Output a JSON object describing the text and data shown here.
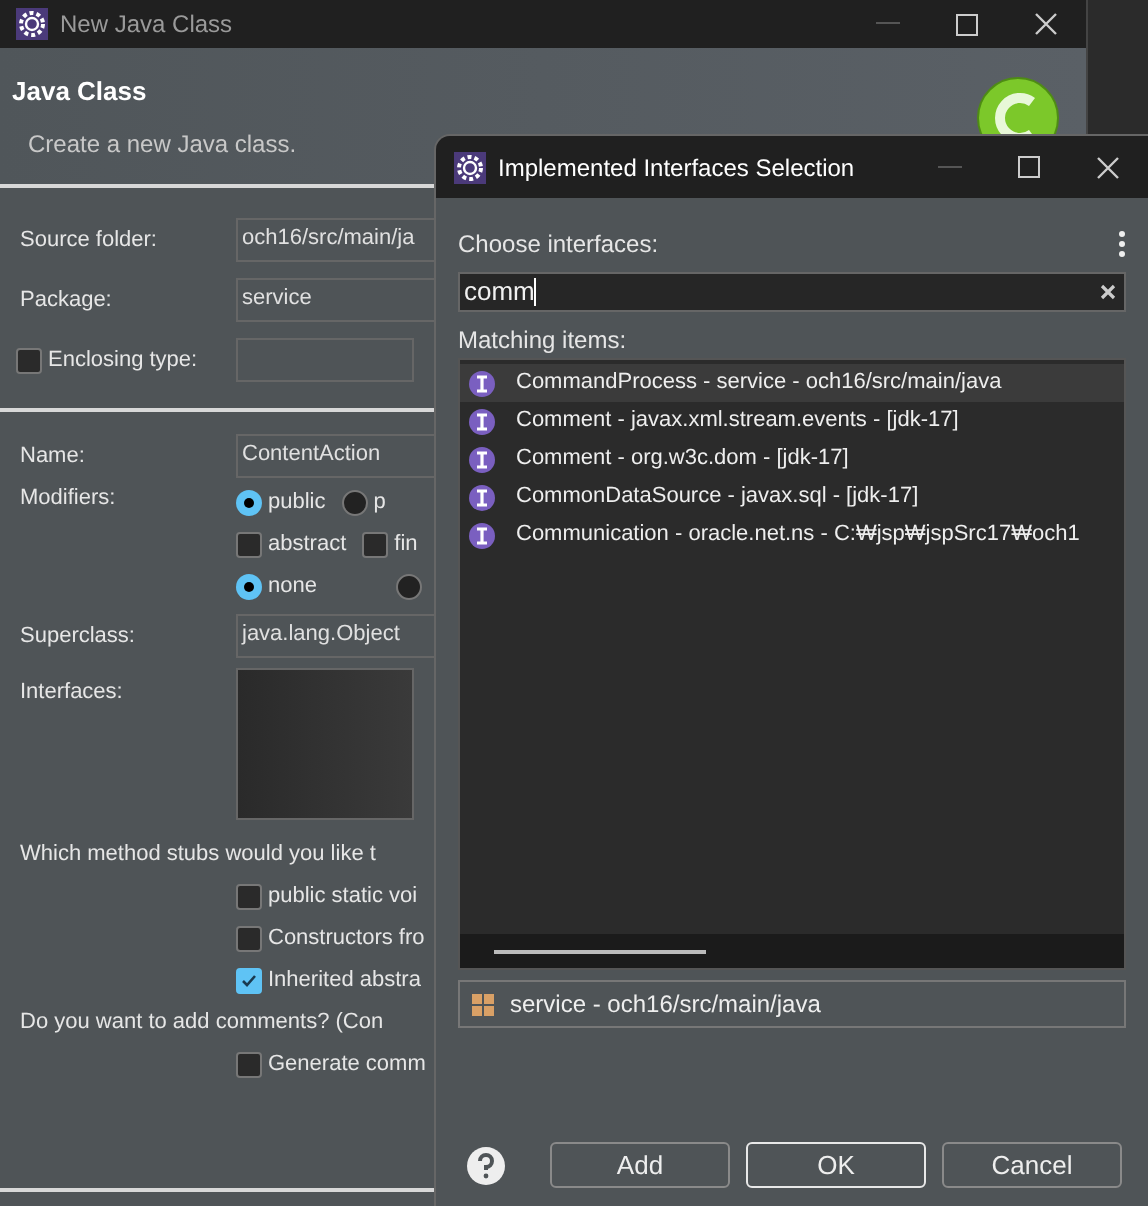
{
  "main_window": {
    "title": "New Java Class",
    "heading": "Java Class",
    "description": "Create a new Java class.",
    "source_folder": {
      "label": "Source folder:",
      "value": "och16/src/main/ja"
    },
    "package": {
      "label": "Package:",
      "value": "service"
    },
    "enclosing_type": {
      "label": "Enclosing type:",
      "checked": false
    },
    "name": {
      "label": "Name:",
      "value": "ContentAction"
    },
    "modifiers": {
      "label": "Modifiers:",
      "access": [
        {
          "label": "public",
          "selected": true
        },
        {
          "label": "p",
          "selected": false
        }
      ],
      "flags": [
        {
          "label": "abstract",
          "checked": false
        },
        {
          "label": "fin",
          "checked": false
        }
      ],
      "nesting": [
        {
          "label": "none",
          "selected": true
        },
        {
          "selected": false
        }
      ]
    },
    "superclass": {
      "label": "Superclass:",
      "value": "java.lang.Object"
    },
    "interfaces": {
      "label": "Interfaces:"
    },
    "stubs": {
      "question": "Which method stubs would you like t",
      "options": [
        {
          "label": "public static voi",
          "checked": false
        },
        {
          "label": "Constructors fro",
          "checked": false
        },
        {
          "label": "Inherited abstra",
          "checked": true
        }
      ]
    },
    "comments": {
      "question": "Do you want to add comments? (Con",
      "options": [
        {
          "label": "Generate comm",
          "checked": false
        }
      ]
    }
  },
  "dialog": {
    "title": "Implemented Interfaces Selection",
    "prompt": "Choose interfaces:",
    "search": {
      "value": "comm"
    },
    "matching_label": "Matching items:",
    "items": [
      {
        "label": "CommandProcess - service - och16/src/main/java",
        "selected": true
      },
      {
        "label": "Comment - javax.xml.stream.events - [jdk-17]",
        "selected": false
      },
      {
        "label": "Comment - org.w3c.dom - [jdk-17]",
        "selected": false
      },
      {
        "label": "CommonDataSource - javax.sql - [jdk-17]",
        "selected": false
      },
      {
        "label": "Communication - oracle.net.ns - C:₩jsp₩jspSrc17₩och1",
        "selected": false
      }
    ],
    "status": "service - och16/src/main/java",
    "buttons": [
      {
        "label": "Add",
        "default": false
      },
      {
        "label": "OK",
        "default": true
      },
      {
        "label": "Cancel",
        "default": false
      }
    ]
  }
}
